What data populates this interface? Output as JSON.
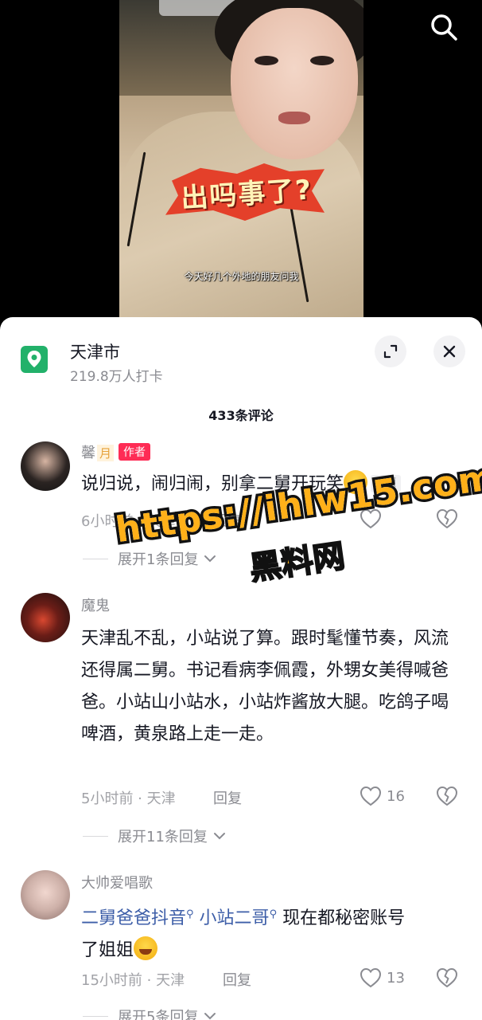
{
  "video": {
    "sticker_text": "出吗事了?",
    "subtitle": "今天好几个外地的朋友问我",
    "search_icon": "search-icon"
  },
  "location": {
    "title": "天津市",
    "subtitle": "219.8万人打卡",
    "icon": "map-pin-icon",
    "accent": "#22b16a"
  },
  "comments_header": {
    "count_label": "433条评论"
  },
  "comments": [
    {
      "username": "馨",
      "username_tag": "月",
      "author_badge": "作者",
      "text": "说归说，闹归闹，别拿二舅开玩笑",
      "pinned_label": "置顶",
      "meta": "6小时前 · 天津",
      "reply_label": "回复",
      "expand_label": "展开1条回复"
    },
    {
      "username": "魔鬼",
      "text": "天津乱不乱，小站说了算。跟时髦懂节奏，风流还得属二舅。书记看病李佩霞，外甥女美得喊爸爸。小站山小站水，小站炸酱放大腿。吃鸽子喝啤酒，黄泉路上走一走。",
      "meta": "5小时前 · 天津",
      "reply_label": "回复",
      "likes": "16",
      "expand_label": "展开11条回复"
    },
    {
      "username": "大帅爱唱歌",
      "mention_1": "二舅爸爸抖音",
      "mention_2": "小站二哥",
      "text_rest": "现在都秘密账号",
      "text_line2": "了姐姐",
      "meta": "15小时前 · 天津",
      "reply_label": "回复",
      "likes": "13",
      "expand_label": "展开5条回复"
    }
  ],
  "watermark": {
    "url": "https://ihlw15.com",
    "name": "黑料网"
  },
  "colors": {
    "author_badge": "#fe2c55",
    "mention": "#3d5ea8",
    "watermark": "#ffb019"
  }
}
